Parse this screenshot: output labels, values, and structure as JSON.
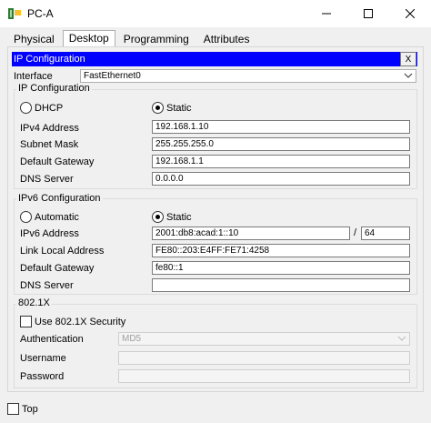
{
  "window": {
    "title": "PC-A"
  },
  "tabs": [
    "Physical",
    "Desktop",
    "Programming",
    "Attributes"
  ],
  "active_tab": "Desktop",
  "ip_config_bar": {
    "title": "IP Configuration",
    "close_label": "X"
  },
  "interface": {
    "label": "Interface",
    "value": "FastEthernet0"
  },
  "ipv4": {
    "group_title": "IP Configuration",
    "dhcp_label": "DHCP",
    "static_label": "Static",
    "selected": "Static",
    "address_label": "IPv4 Address",
    "address": "192.168.1.10",
    "mask_label": "Subnet Mask",
    "mask": "255.255.255.0",
    "gateway_label": "Default Gateway",
    "gateway": "192.168.1.1",
    "dns_label": "DNS Server",
    "dns": "0.0.0.0"
  },
  "ipv6": {
    "group_title": "IPv6 Configuration",
    "auto_label": "Automatic",
    "static_label": "Static",
    "selected": "Static",
    "address_label": "IPv6 Address",
    "address": "2001:db8:acad:1::10",
    "slash": "/",
    "prefix": "64",
    "link_local_label": "Link Local Address",
    "link_local": "FE80::203:E4FF:FE71:4258",
    "gateway_label": "Default Gateway",
    "gateway": "fe80::1",
    "dns_label": "DNS Server",
    "dns": ""
  },
  "dot1x": {
    "group_title": "802.1X",
    "use_label": "Use 802.1X Security",
    "auth_label": "Authentication",
    "auth_value": "MD5",
    "username_label": "Username",
    "username": "",
    "password_label": "Password",
    "password": ""
  },
  "footer": {
    "top_label": "Top"
  }
}
